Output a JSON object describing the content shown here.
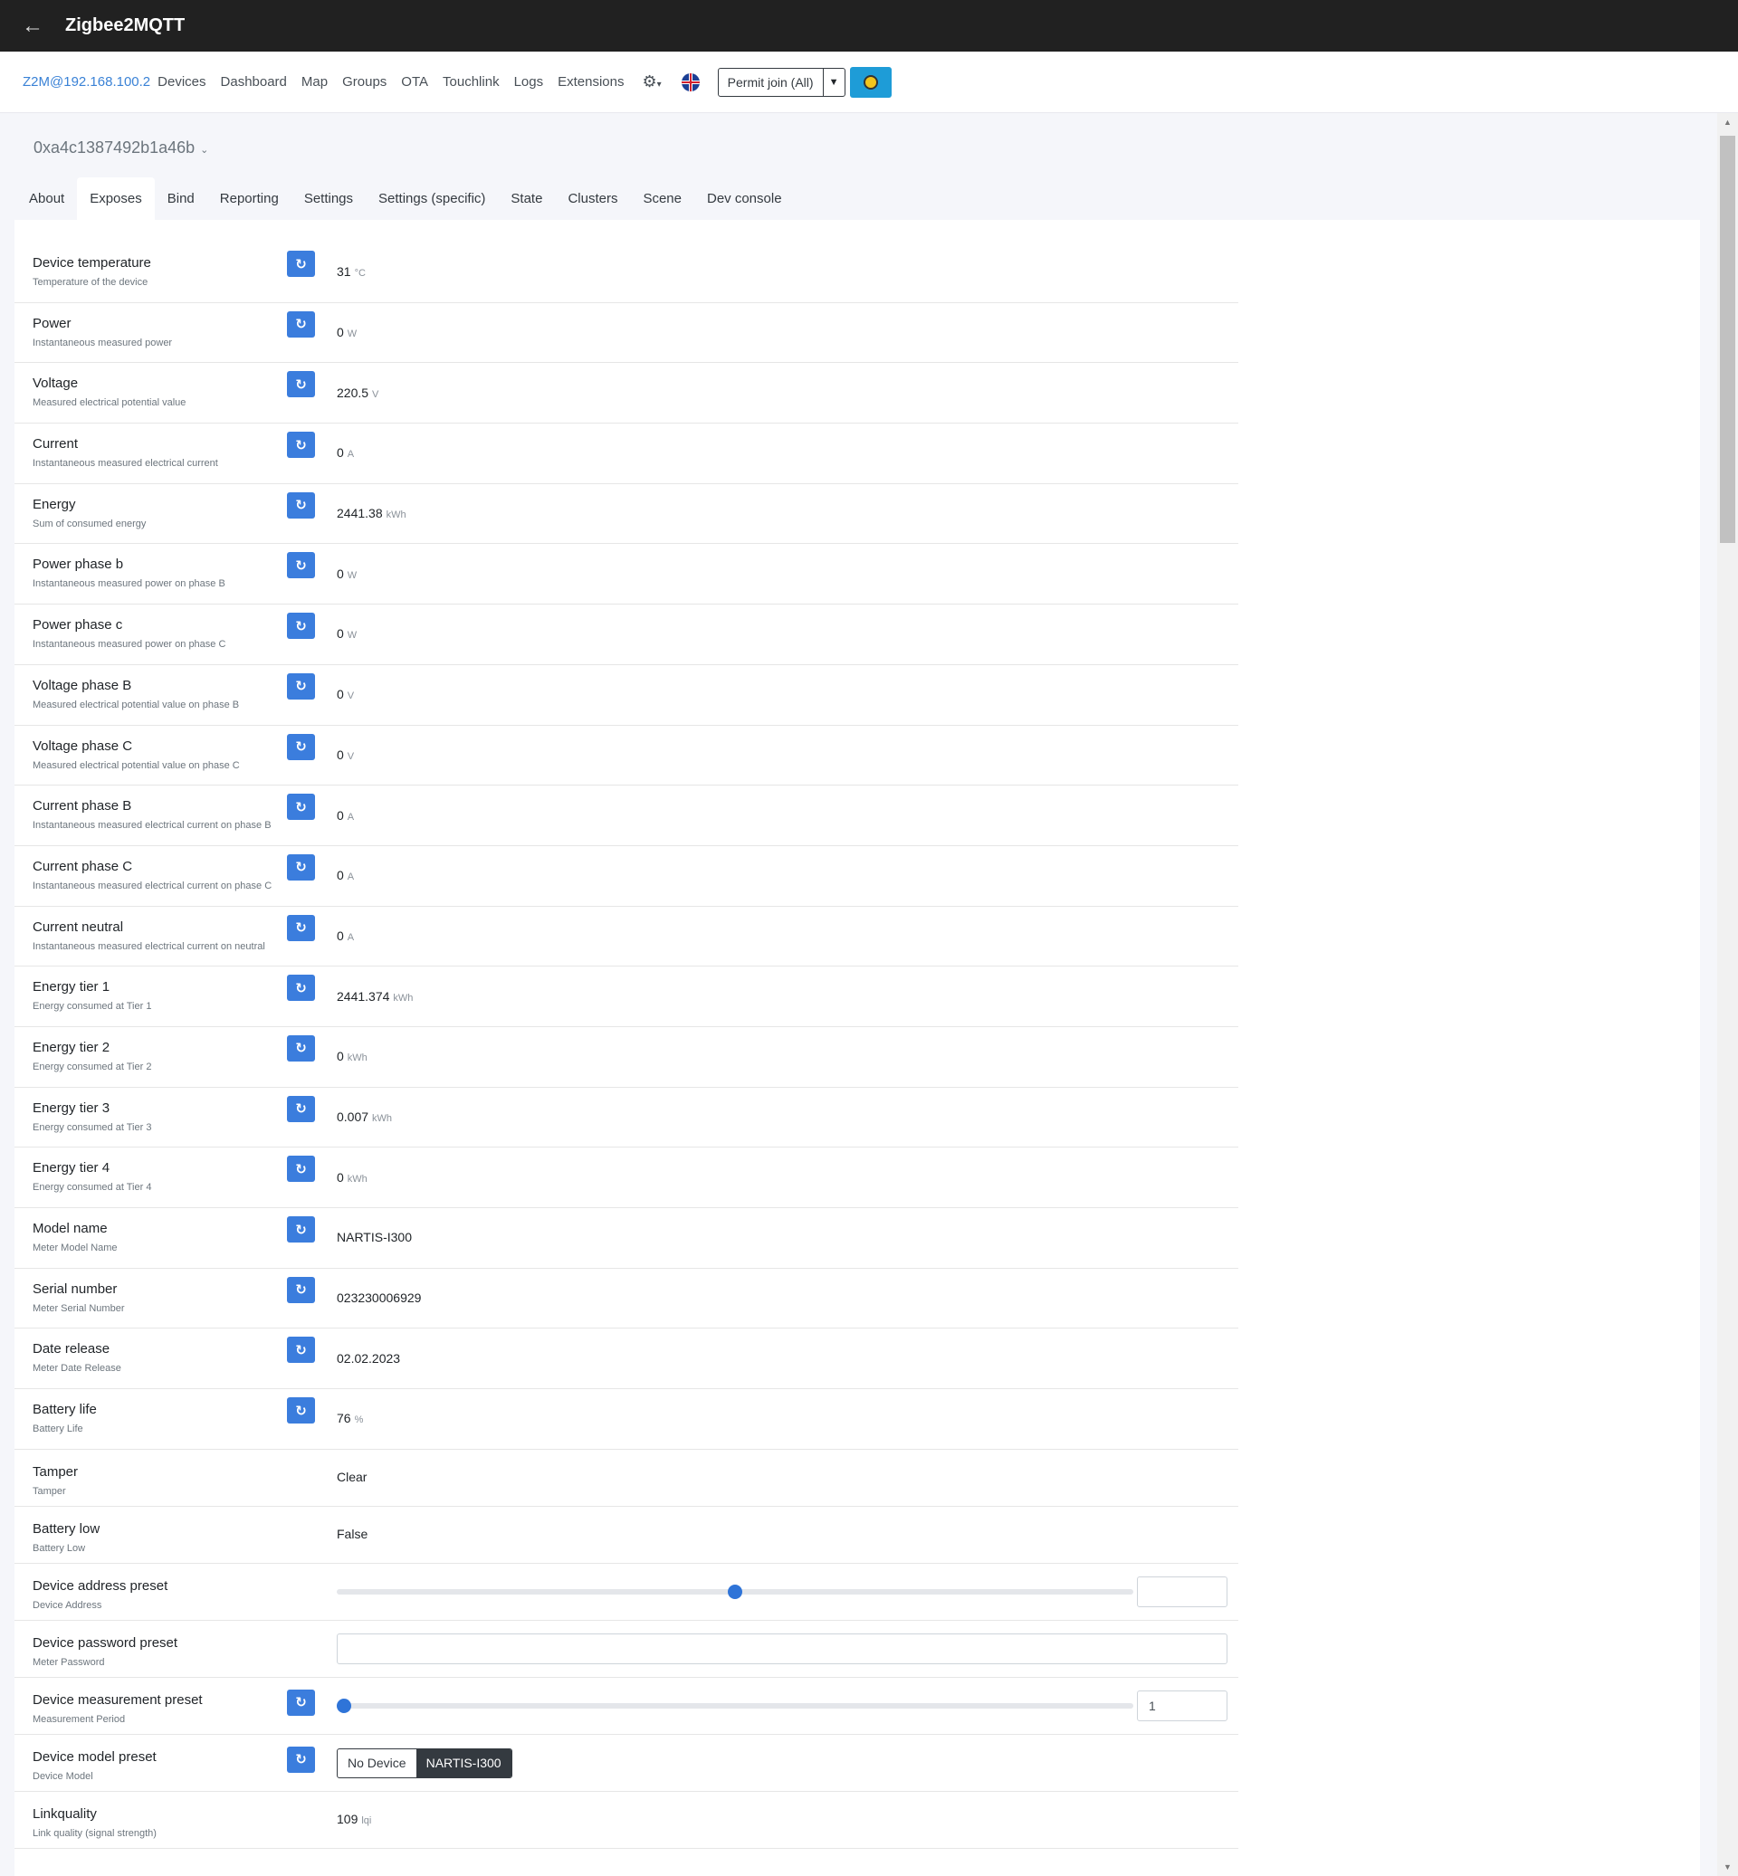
{
  "app": {
    "title": "Zigbee2MQTT"
  },
  "navbar": {
    "brand": "Z2M@192.168.100.2",
    "links": [
      "Devices",
      "Dashboard",
      "Map",
      "Groups",
      "OTA",
      "Touchlink",
      "Logs",
      "Extensions"
    ],
    "permit_label": "Permit join (All)"
  },
  "device": {
    "id": "0xa4c1387492b1a46b"
  },
  "tabs": [
    "About",
    "Exposes",
    "Bind",
    "Reporting",
    "Settings",
    "Settings (specific)",
    "State",
    "Clusters",
    "Scene",
    "Dev console"
  ],
  "active_tab": "Exposes",
  "rows": [
    {
      "name": "Device temperature",
      "desc": "Temperature of the device",
      "value": "31",
      "unit": "°C"
    },
    {
      "name": "Power",
      "desc": "Instantaneous measured power",
      "value": "0",
      "unit": "W"
    },
    {
      "name": "Voltage",
      "desc": "Measured electrical potential value",
      "value": "220.5",
      "unit": "V"
    },
    {
      "name": "Current",
      "desc": "Instantaneous measured electrical current",
      "value": "0",
      "unit": "A"
    },
    {
      "name": "Energy",
      "desc": "Sum of consumed energy",
      "value": "2441.38",
      "unit": "kWh"
    },
    {
      "name": "Power phase b",
      "desc": "Instantaneous measured power on phase B",
      "value": "0",
      "unit": "W"
    },
    {
      "name": "Power phase c",
      "desc": "Instantaneous measured power on phase C",
      "value": "0",
      "unit": "W"
    },
    {
      "name": "Voltage phase B",
      "desc": "Measured electrical potential value on phase B",
      "value": "0",
      "unit": "V"
    },
    {
      "name": "Voltage phase C",
      "desc": "Measured electrical potential value on phase C",
      "value": "0",
      "unit": "V"
    },
    {
      "name": "Current phase B",
      "desc": "Instantaneous measured electrical current on phase B",
      "value": "0",
      "unit": "A"
    },
    {
      "name": "Current phase C",
      "desc": "Instantaneous measured electrical current on phase C",
      "value": "0",
      "unit": "A"
    },
    {
      "name": "Current neutral",
      "desc": "Instantaneous measured electrical current on neutral",
      "value": "0",
      "unit": "A"
    },
    {
      "name": "Energy tier 1",
      "desc": "Energy consumed at Tier 1",
      "value": "2441.374",
      "unit": "kWh"
    },
    {
      "name": "Energy tier 2",
      "desc": "Energy consumed at Tier 2",
      "value": "0",
      "unit": "kWh"
    },
    {
      "name": "Energy tier 3",
      "desc": "Energy consumed at Tier 3",
      "value": "0.007",
      "unit": "kWh"
    },
    {
      "name": "Energy tier 4",
      "desc": "Energy consumed at Tier 4",
      "value": "0",
      "unit": "kWh"
    },
    {
      "name": "Model name",
      "desc": "Meter Model Name",
      "value": "NARTIS-I300",
      "unit": ""
    },
    {
      "name": "Serial number",
      "desc": "Meter Serial Number",
      "value": "023230006929",
      "unit": ""
    },
    {
      "name": "Date release",
      "desc": "Meter Date Release",
      "value": "02.02.2023",
      "unit": ""
    },
    {
      "name": "Battery life",
      "desc": "Battery Life",
      "value": "76",
      "unit": "%"
    },
    {
      "name": "Tamper",
      "desc": "Tamper",
      "value": "Clear"
    },
    {
      "name": "Battery low",
      "desc": "Battery Low",
      "value": "False"
    },
    {
      "name": "Device address preset",
      "desc": "Device Address",
      "slider_fraction": 0.5,
      "input_value": ""
    },
    {
      "name": "Device password preset",
      "desc": "Meter Password",
      "input_value": ""
    },
    {
      "name": "Device measurement preset",
      "desc": "Measurement Period",
      "slider_fraction": 0.0,
      "input_value": "1"
    },
    {
      "name": "Device model preset",
      "desc": "Device Model",
      "options": [
        "No Device",
        "NARTIS-I300"
      ],
      "selected": "NARTIS-I300"
    },
    {
      "name": "Linkquality",
      "desc": "Link quality (signal strength)",
      "value": "109",
      "unit": "lqi"
    }
  ],
  "icons": {
    "back": "arrow-left-icon",
    "refresh": "refresh-icon",
    "settings": "gear-icon",
    "language": "uk-flag-icon",
    "health": "sun-icon"
  },
  "colors": {
    "accent": "#3b7ddd",
    "topbar": "#212121",
    "health_button": "#1e9cd7"
  }
}
